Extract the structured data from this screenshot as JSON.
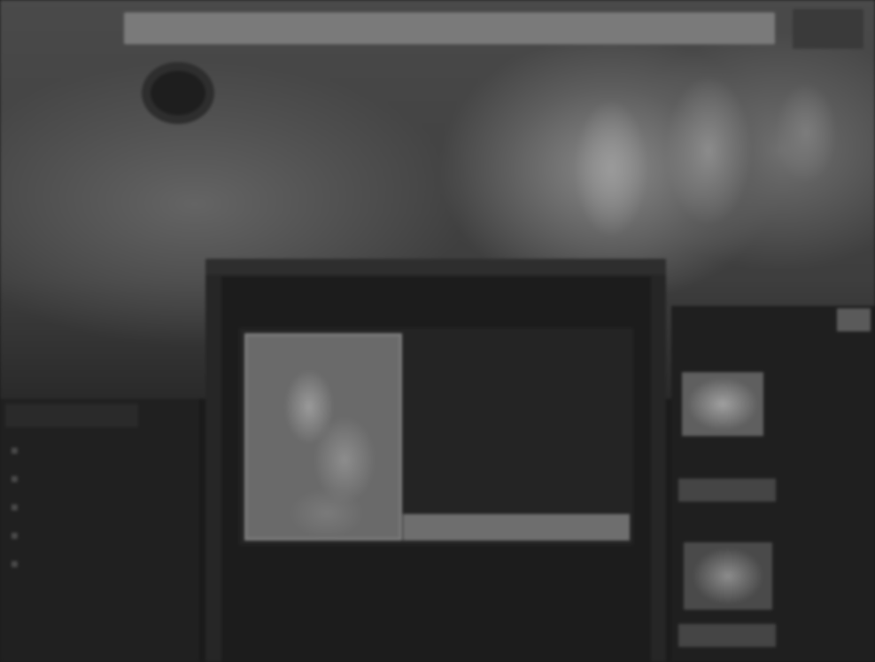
{
  "header": {
    "nav_links": [
      "",
      "",
      ""
    ],
    "logo_text": "",
    "tagline": "",
    "sub_logo": "",
    "sub_tagline": ""
  },
  "left_sidebar": {
    "heading": "",
    "items": [
      "",
      "",
      "",
      "",
      ""
    ]
  },
  "main": {
    "title": "",
    "feature_lines": [
      "",
      "",
      "",
      "",
      "",
      ""
    ],
    "article_heading": "",
    "article_text": ""
  },
  "right_sidebar": {
    "heading": "",
    "caption_1": "",
    "button_1": "",
    "caption_2": "",
    "button_2": ""
  },
  "colors": {
    "page_background": "#1b1b1b",
    "banner": "#4a4a4a",
    "top_bar": "#7a7a7a"
  }
}
